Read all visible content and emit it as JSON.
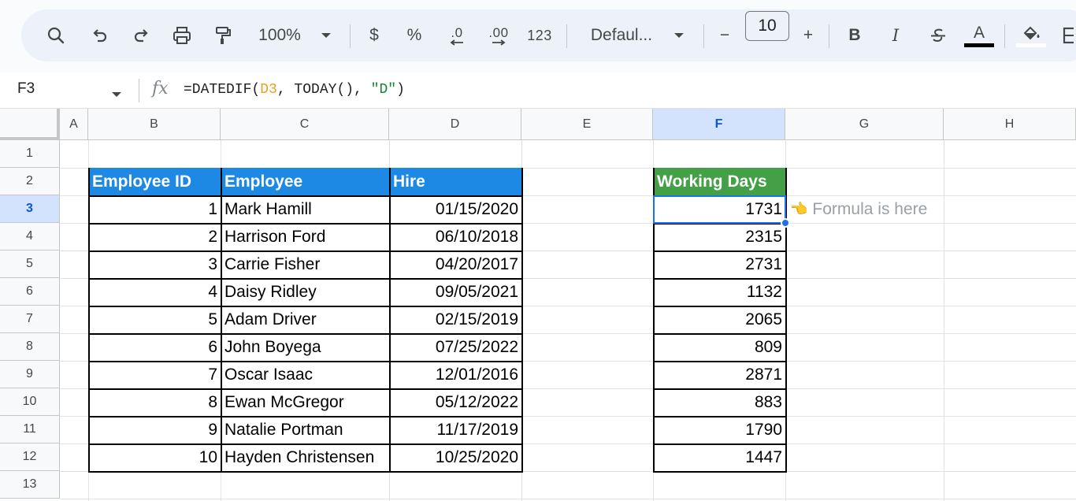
{
  "toolbar": {
    "zoom": "100%",
    "currency": "$",
    "percent": "%",
    "decrease_decimals": ".0",
    "increase_decimals": ".00",
    "number_format": "123",
    "font": "Defaul...",
    "font_size": "10",
    "minus": "−",
    "plus": "+",
    "bold": "B",
    "italic": "I",
    "text_color_letter": "A"
  },
  "formula_bar": {
    "cell_ref": "F3",
    "fx": "fx",
    "formula_prefix": "=DATEDIF(",
    "formula_ref": "D3",
    "formula_middle": ", TODAY(), ",
    "formula_string": "\"D\"",
    "formula_suffix": ")"
  },
  "columns": [
    "A",
    "B",
    "C",
    "D",
    "E",
    "F",
    "G",
    "H"
  ],
  "selected_column": "F",
  "rows": [
    "1",
    "2",
    "3",
    "4",
    "5",
    "6",
    "7",
    "8",
    "9",
    "10",
    "11",
    "12",
    "13"
  ],
  "selected_row": "3",
  "table": {
    "headers": {
      "id": "Employee ID",
      "name": "Employee",
      "hire": "Hire"
    },
    "rows": [
      {
        "id": "1",
        "name": "Mark Hamill",
        "hire": "01/15/2020"
      },
      {
        "id": "2",
        "name": "Harrison Ford",
        "hire": "06/10/2018"
      },
      {
        "id": "3",
        "name": "Carrie Fisher",
        "hire": "04/20/2017"
      },
      {
        "id": "4",
        "name": "Daisy Ridley",
        "hire": "09/05/2021"
      },
      {
        "id": "5",
        "name": "Adam Driver",
        "hire": "02/15/2019"
      },
      {
        "id": "6",
        "name": "John Boyega",
        "hire": "07/25/2022"
      },
      {
        "id": "7",
        "name": "Oscar Isaac",
        "hire": "12/01/2016"
      },
      {
        "id": "8",
        "name": "Ewan McGregor",
        "hire": "05/12/2022"
      },
      {
        "id": "9",
        "name": "Natalie Portman",
        "hire": "11/17/2019"
      },
      {
        "id": "10",
        "name": "Hayden Christensen",
        "hire": "10/25/2020"
      }
    ]
  },
  "working_days": {
    "header": "Working Days",
    "values": [
      "1731",
      "2315",
      "2731",
      "1132",
      "2065",
      "809",
      "2871",
      "883",
      "1790",
      "1447"
    ]
  },
  "note": {
    "emoji": "👈",
    "text": "Formula is here"
  },
  "colors": {
    "table_header": "#1e88e5",
    "working_days_header": "#43a047",
    "selection": "#1a73e8"
  }
}
